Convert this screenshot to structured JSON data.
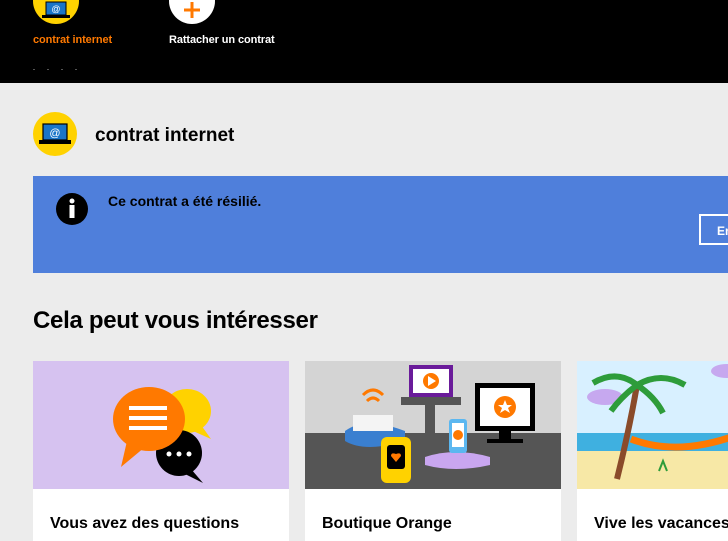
{
  "topbar": {
    "items": [
      {
        "label": "contrat internet",
        "icon": "laptop-icon",
        "active": true
      },
      {
        "label": "Rattacher un contrat",
        "icon": "plus-icon",
        "active": false
      }
    ]
  },
  "contract": {
    "title": "contrat internet",
    "icon": "laptop-icon"
  },
  "banner": {
    "message": "Ce contrat a été résilié.",
    "button_label": "En",
    "icon": "info-icon",
    "color": "#4f7fdb"
  },
  "section": {
    "title": "Cela peut vous intéresser"
  },
  "cards": [
    {
      "title": "Vous avez des questions",
      "image": "chat-bubbles-illustration",
      "bg": "#d6c2f0"
    },
    {
      "title": "Boutique Orange",
      "image": "devices-illustration",
      "bg": "#d4d4d4"
    },
    {
      "title": "Vive les vacances",
      "image": "beach-illustration",
      "bg": "#d8f0ff"
    }
  ],
  "colors": {
    "brand_orange": "#ff7900",
    "yellow": "#ffd200",
    "background": "#ececec"
  }
}
